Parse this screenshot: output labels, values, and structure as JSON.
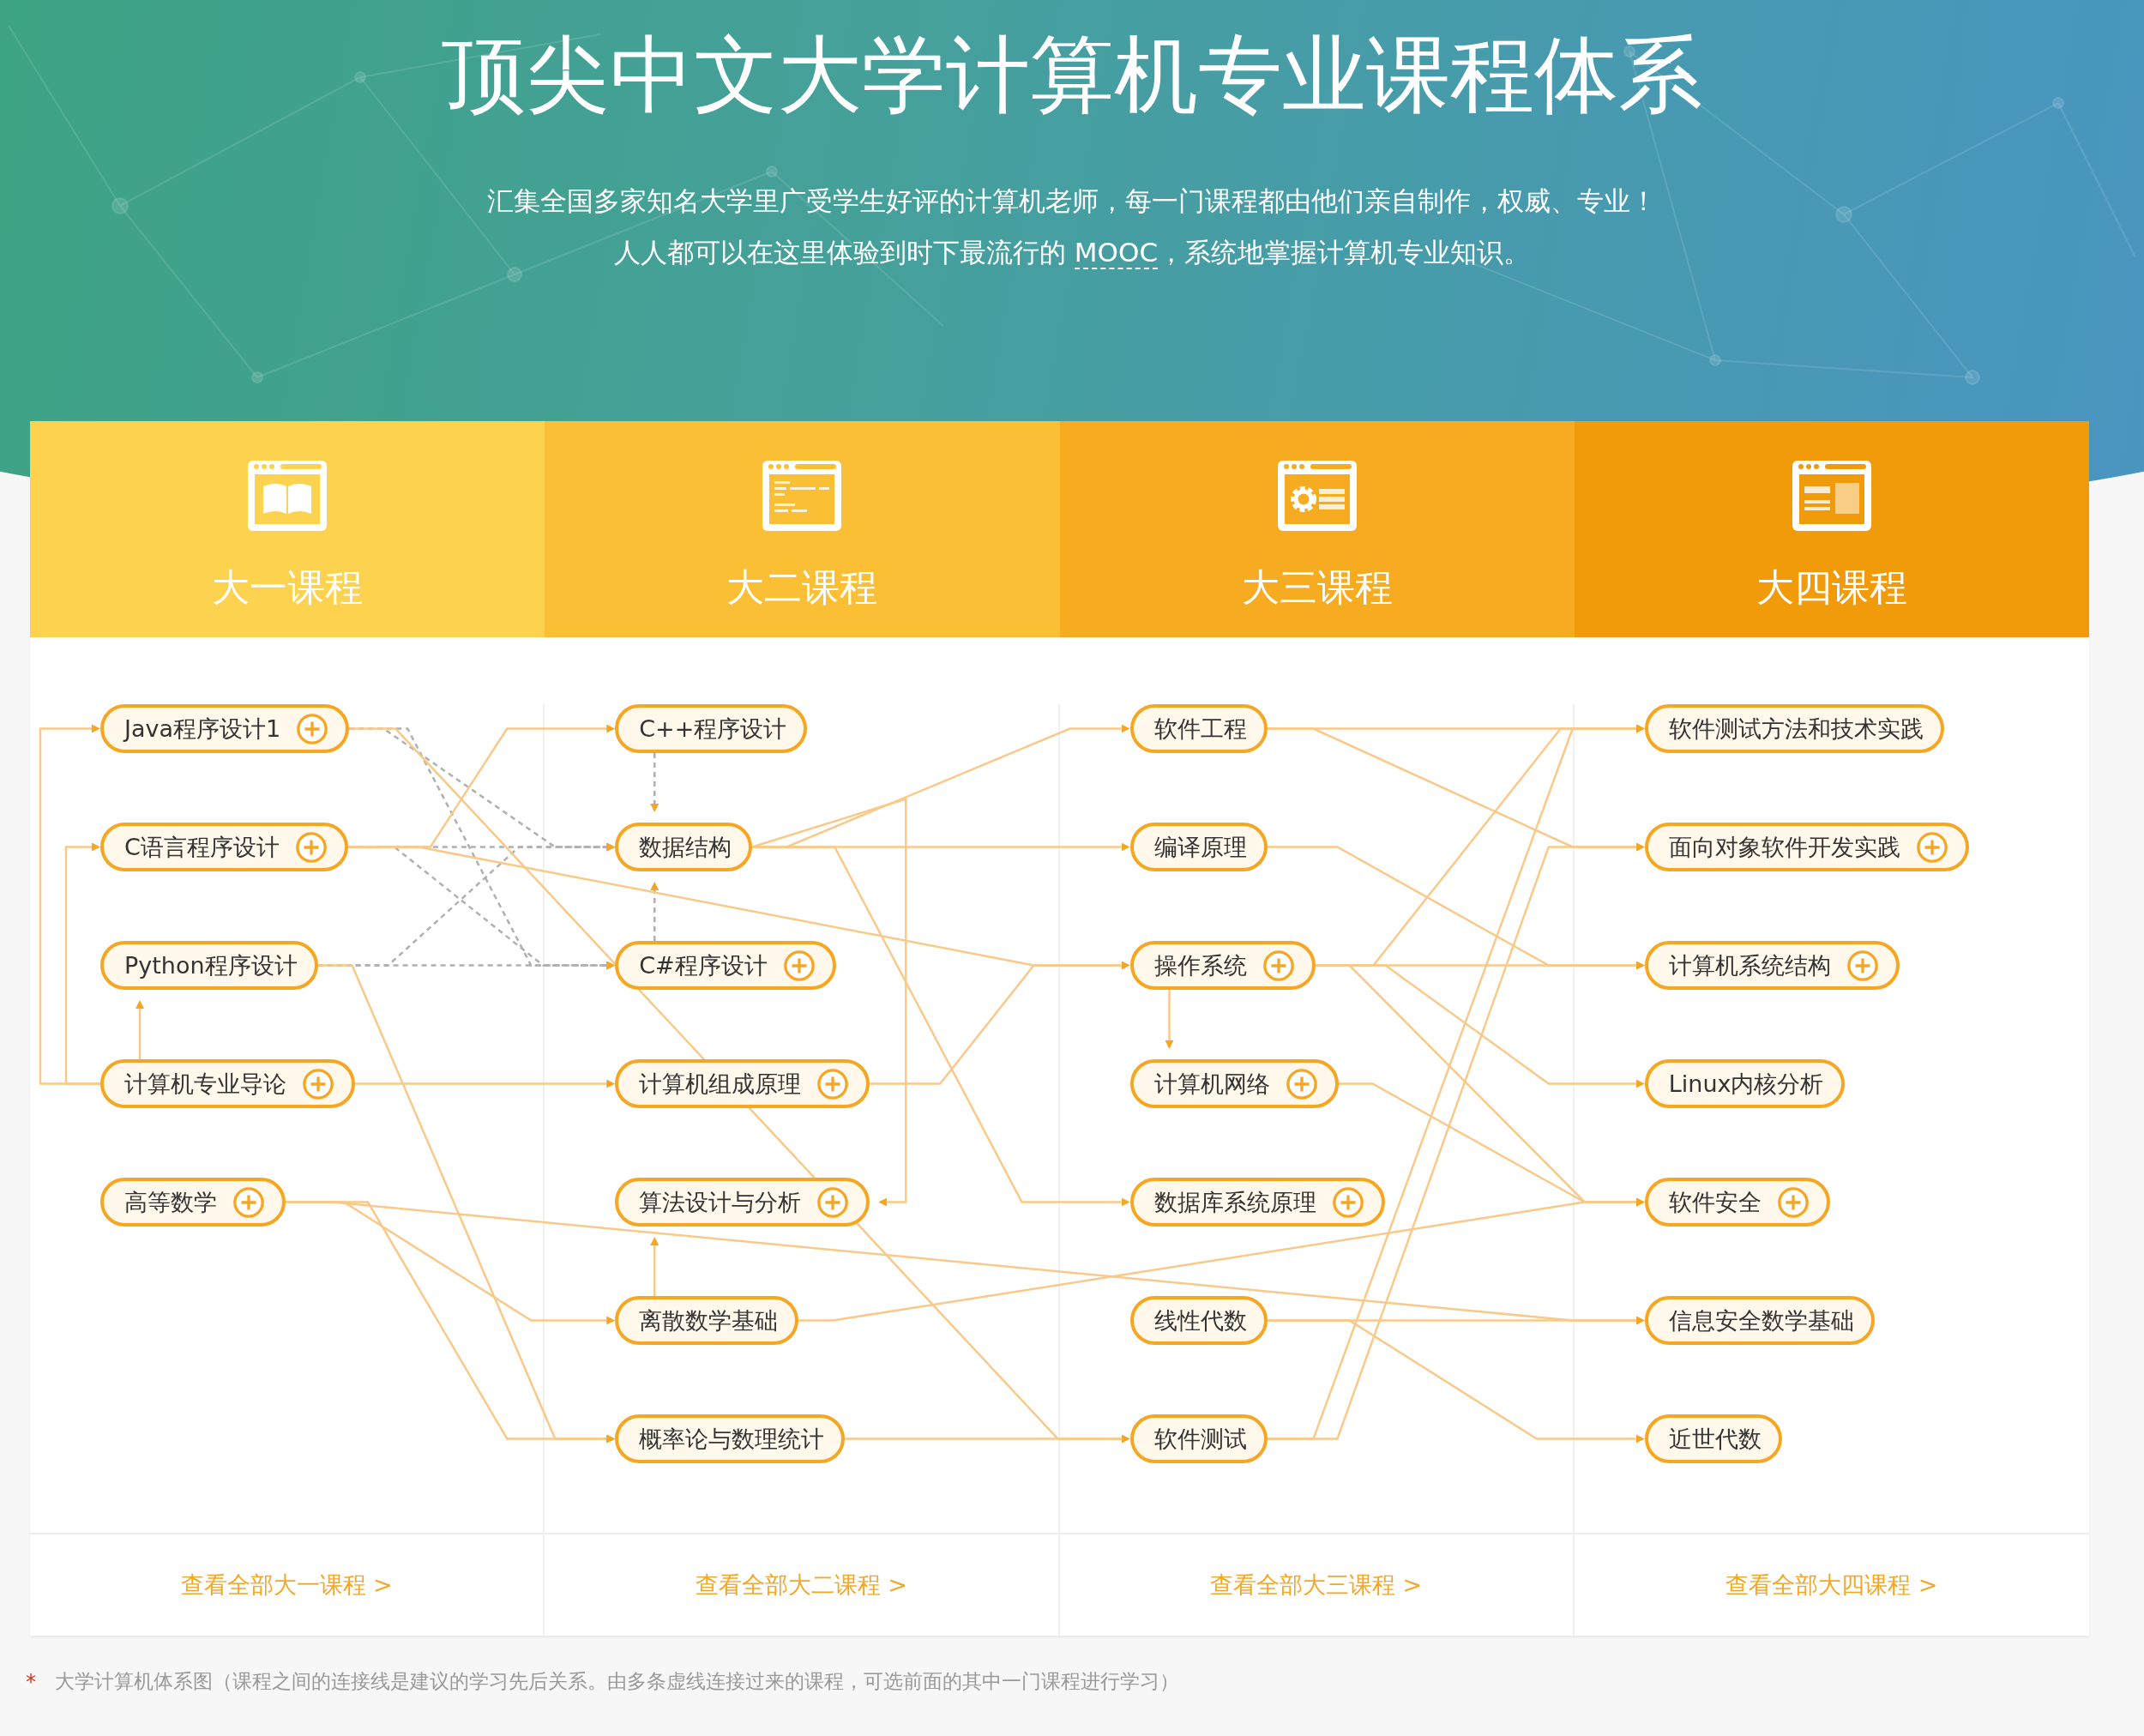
{
  "title": "顶尖中文大学计算机专业课程体系",
  "intro": {
    "line1": "汇集全国多家知名大学里广受学生好评的计算机老师，每一门课程都由他们亲自制作，权威、专业！",
    "line2_before": "人人都可以在这里体验到时下最流行的 ",
    "line2_link": "MOOC",
    "line2_after": "，系统地掌握计算机专业知识。"
  },
  "columns": [
    {
      "title": "大一课程",
      "more_link": "查看全部大一课程 >",
      "courses": [
        {
          "name": "Java程序设计1",
          "addable": true
        },
        {
          "name": "C语言程序设计",
          "addable": true
        },
        {
          "name": "Python程序设计",
          "addable": false
        },
        {
          "name": "计算机专业导论",
          "addable": true
        },
        {
          "name": "高等数学",
          "addable": true
        }
      ]
    },
    {
      "title": "大二课程",
      "more_link": "查看全部大二课程 >",
      "courses": [
        {
          "name": "C++程序设计",
          "addable": false
        },
        {
          "name": "数据结构",
          "addable": false
        },
        {
          "name": "C#程序设计",
          "addable": true
        },
        {
          "name": "计算机组成原理",
          "addable": true
        },
        {
          "name": "算法设计与分析",
          "addable": true
        },
        {
          "name": "离散数学基础",
          "addable": false
        },
        {
          "name": "概率论与数理统计",
          "addable": false
        }
      ]
    },
    {
      "title": "大三课程",
      "more_link": "查看全部大三课程 >",
      "courses": [
        {
          "name": "软件工程",
          "addable": false
        },
        {
          "name": "编译原理",
          "addable": false
        },
        {
          "name": "操作系统",
          "addable": true
        },
        {
          "name": "计算机网络",
          "addable": true
        },
        {
          "name": "数据库系统原理",
          "addable": true
        },
        {
          "name": "线性代数",
          "addable": false
        },
        {
          "name": "软件测试",
          "addable": false
        }
      ]
    },
    {
      "title": "大四课程",
      "more_link": "查看全部大四课程 >",
      "courses": [
        {
          "name": "软件测试方法和技术实践",
          "addable": false
        },
        {
          "name": "面向对象软件开发实践",
          "addable": true
        },
        {
          "name": "计算机系统结构",
          "addable": true
        },
        {
          "name": "Linux内核分析",
          "addable": false
        },
        {
          "name": "软件安全",
          "addable": true
        },
        {
          "name": "信息安全数学基础",
          "addable": false
        },
        {
          "name": "近世代数",
          "addable": false
        }
      ]
    }
  ],
  "footnote": {
    "mark": "*",
    "text": "大学计算机体系图（课程之间的连接线是建议的学习先后关系。由多条虚线连接过来的课程，可选前面的其中一门课程进行学习）"
  }
}
